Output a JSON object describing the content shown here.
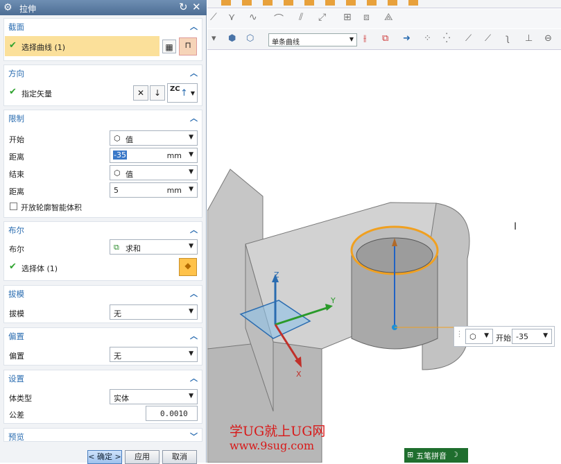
{
  "dialog": {
    "title": "拉伸",
    "section_section": {
      "header": "截面",
      "select_curve": "选择曲线 (1)"
    },
    "section_direction": {
      "header": "方向",
      "specify_vector": "指定矢量",
      "vector_label": "ZC"
    },
    "section_limits": {
      "header": "限制",
      "start_label": "开始",
      "start_value": "值",
      "distance1_label": "距离",
      "distance1_value": "-35",
      "distance1_unit": "mm",
      "end_label": "结束",
      "end_value": "值",
      "distance2_label": "距离",
      "distance2_value": "5",
      "distance2_unit": "mm",
      "open_profile": "开放轮廓智能体积"
    },
    "section_boolean": {
      "header": "布尔",
      "boolean_label": "布尔",
      "boolean_value": "求和",
      "select_body": "选择体 (1)"
    },
    "section_draft": {
      "header": "拔模",
      "draft_label": "拔模",
      "draft_value": "无"
    },
    "section_offset": {
      "header": "偏置",
      "offset_label": "偏置",
      "offset_value": "无"
    },
    "section_settings": {
      "header": "设置",
      "body_type_label": "体类型",
      "body_type_value": "实体",
      "tolerance_label": "公差",
      "tolerance_value": "0.0010"
    },
    "section_preview": {
      "header": "预览"
    },
    "buttons": {
      "ok": "< 确定 >",
      "apply": "应用",
      "cancel": "取消"
    }
  },
  "toolbar": {
    "curve_rule": "单条曲线"
  },
  "viewport": {
    "axis_z": "Z",
    "axis_y": "Y",
    "axis_x": "X",
    "mini_toolbar": {
      "start_label": "开始",
      "start_value": "-35"
    }
  },
  "watermark": {
    "line1": "学UG就上UG网",
    "line2": "www.9sug.com"
  },
  "ime": {
    "label": "五笔拼音"
  },
  "colors": {
    "title_bar": "#5a7ba2",
    "section_header": "#2a6cb0",
    "highlight": "#fbe09a",
    "check": "#2fa32f",
    "watermark": "#d81818"
  }
}
